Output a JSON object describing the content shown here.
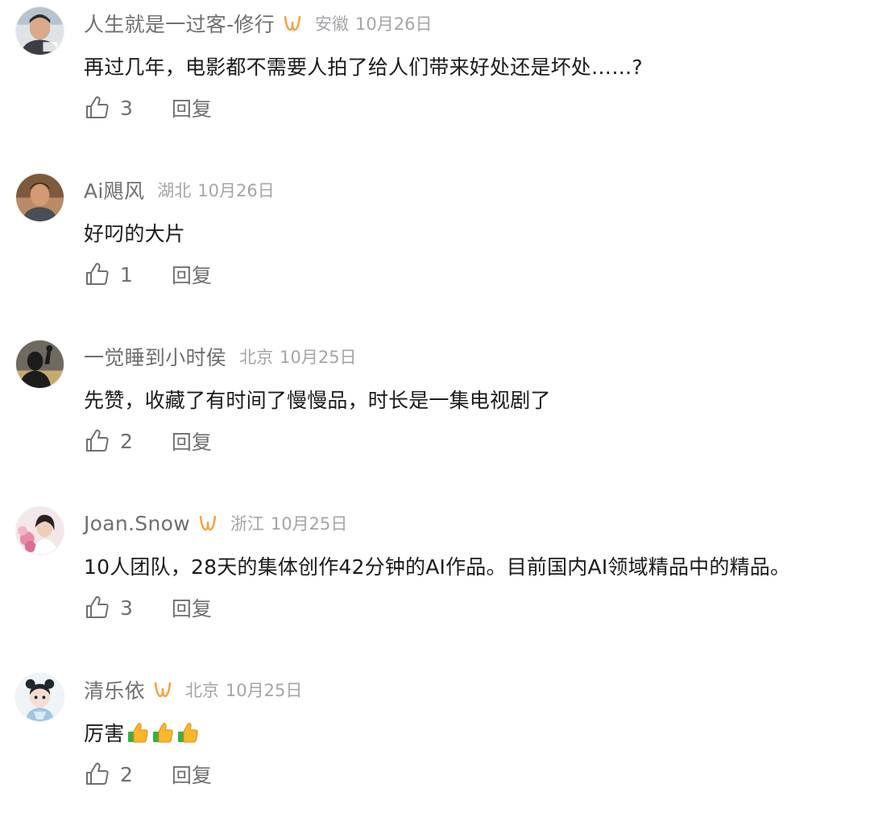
{
  "comments": [
    {
      "username": "人生就是一过客-修行",
      "badge": true,
      "location": "安徽",
      "date": "10月26日",
      "text": "再过几年，电影都不需要人拍了给人们带来好处还是坏处……?",
      "likes": "3",
      "reply_label": "回复",
      "thumbs_emoji_count": 0,
      "avatar": "man-portrait-avatar"
    },
    {
      "username": "Ai飓风",
      "badge": false,
      "location": "湖北",
      "date": "10月26日",
      "text": "好叼的大片",
      "likes": "1",
      "reply_label": "回复",
      "thumbs_emoji_count": 0,
      "avatar": "cartoon-man-avatar"
    },
    {
      "username": "一觉睡到小时侯",
      "badge": false,
      "location": "北京",
      "date": "10月25日",
      "text": "先赞，收藏了有时间了慢慢品，时长是一集电视剧了",
      "likes": "2",
      "reply_label": "回复",
      "thumbs_emoji_count": 0,
      "avatar": "silhouette-avatar"
    },
    {
      "username": "Joan.Snow",
      "badge": true,
      "location": "浙江",
      "date": "10月25日",
      "text": "10人团队，28天的集体创作42分钟的AI作品。目前国内AI领域精品中的精品。",
      "likes": "3",
      "reply_label": "回复",
      "thumbs_emoji_count": 0,
      "avatar": "woman-flowers-avatar"
    },
    {
      "username": "清乐依",
      "badge": true,
      "location": "北京",
      "date": "10月25日",
      "text": "厉害",
      "likes": "2",
      "reply_label": "回复",
      "thumbs_emoji_count": 3,
      "avatar": "cartoon-girl-avatar"
    }
  ],
  "icons": {
    "like": "thumbs-up-outline-icon",
    "badge": "orange-wave-badge-icon",
    "emoji": "thumbs-up-emoji"
  },
  "colors": {
    "username": "#6f6f73",
    "meta": "#a4a5a9",
    "text": "#1b1b1f",
    "badge": "#f5a24a"
  }
}
